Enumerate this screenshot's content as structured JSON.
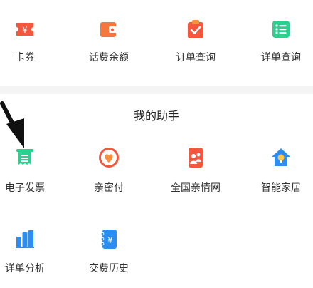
{
  "top_row": [
    {
      "label": "卡券",
      "icon": "coupon-icon"
    },
    {
      "label": "话费余额",
      "icon": "wallet-icon"
    },
    {
      "label": "订单查询",
      "icon": "order-clipboard-icon"
    },
    {
      "label": "详单查询",
      "icon": "list-detail-icon"
    }
  ],
  "helper": {
    "title": "我的助手",
    "row1": [
      {
        "label": "电子发票",
        "icon": "e-invoice-icon"
      },
      {
        "label": "亲密付",
        "icon": "heart-pay-icon"
      },
      {
        "label": "全国亲情网",
        "icon": "family-network-icon"
      },
      {
        "label": "智能家居",
        "icon": "smart-home-icon"
      }
    ],
    "row2": [
      {
        "label": "详单分析",
        "icon": "bar-chart-icon"
      },
      {
        "label": "交费历史",
        "icon": "payment-history-icon"
      }
    ]
  },
  "colors": {
    "red_orange": "#f4573e",
    "orange": "#f7903f",
    "green": "#2ecf8e",
    "blue": "#2b8ef0"
  }
}
